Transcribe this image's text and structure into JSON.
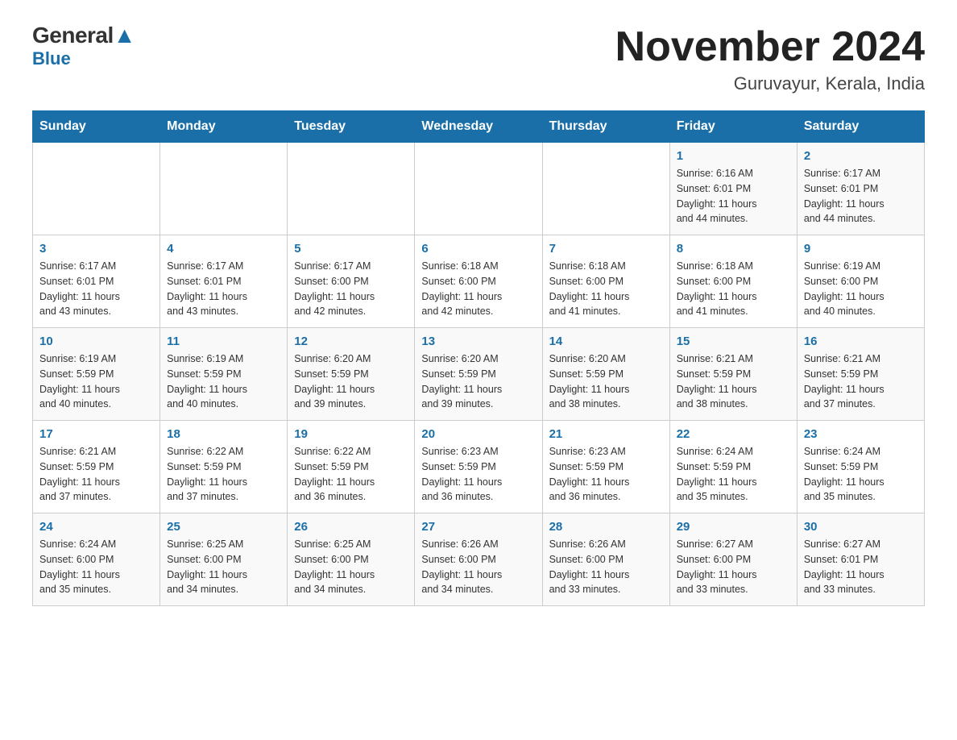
{
  "header": {
    "logo_general": "General",
    "logo_blue": "Blue",
    "month_title": "November 2024",
    "location": "Guruvayur, Kerala, India"
  },
  "days_of_week": [
    "Sunday",
    "Monday",
    "Tuesday",
    "Wednesday",
    "Thursday",
    "Friday",
    "Saturday"
  ],
  "weeks": [
    {
      "days": [
        {
          "number": "",
          "info": ""
        },
        {
          "number": "",
          "info": ""
        },
        {
          "number": "",
          "info": ""
        },
        {
          "number": "",
          "info": ""
        },
        {
          "number": "",
          "info": ""
        },
        {
          "number": "1",
          "info": "Sunrise: 6:16 AM\nSunset: 6:01 PM\nDaylight: 11 hours\nand 44 minutes."
        },
        {
          "number": "2",
          "info": "Sunrise: 6:17 AM\nSunset: 6:01 PM\nDaylight: 11 hours\nand 44 minutes."
        }
      ]
    },
    {
      "days": [
        {
          "number": "3",
          "info": "Sunrise: 6:17 AM\nSunset: 6:01 PM\nDaylight: 11 hours\nand 43 minutes."
        },
        {
          "number": "4",
          "info": "Sunrise: 6:17 AM\nSunset: 6:01 PM\nDaylight: 11 hours\nand 43 minutes."
        },
        {
          "number": "5",
          "info": "Sunrise: 6:17 AM\nSunset: 6:00 PM\nDaylight: 11 hours\nand 42 minutes."
        },
        {
          "number": "6",
          "info": "Sunrise: 6:18 AM\nSunset: 6:00 PM\nDaylight: 11 hours\nand 42 minutes."
        },
        {
          "number": "7",
          "info": "Sunrise: 6:18 AM\nSunset: 6:00 PM\nDaylight: 11 hours\nand 41 minutes."
        },
        {
          "number": "8",
          "info": "Sunrise: 6:18 AM\nSunset: 6:00 PM\nDaylight: 11 hours\nand 41 minutes."
        },
        {
          "number": "9",
          "info": "Sunrise: 6:19 AM\nSunset: 6:00 PM\nDaylight: 11 hours\nand 40 minutes."
        }
      ]
    },
    {
      "days": [
        {
          "number": "10",
          "info": "Sunrise: 6:19 AM\nSunset: 5:59 PM\nDaylight: 11 hours\nand 40 minutes."
        },
        {
          "number": "11",
          "info": "Sunrise: 6:19 AM\nSunset: 5:59 PM\nDaylight: 11 hours\nand 40 minutes."
        },
        {
          "number": "12",
          "info": "Sunrise: 6:20 AM\nSunset: 5:59 PM\nDaylight: 11 hours\nand 39 minutes."
        },
        {
          "number": "13",
          "info": "Sunrise: 6:20 AM\nSunset: 5:59 PM\nDaylight: 11 hours\nand 39 minutes."
        },
        {
          "number": "14",
          "info": "Sunrise: 6:20 AM\nSunset: 5:59 PM\nDaylight: 11 hours\nand 38 minutes."
        },
        {
          "number": "15",
          "info": "Sunrise: 6:21 AM\nSunset: 5:59 PM\nDaylight: 11 hours\nand 38 minutes."
        },
        {
          "number": "16",
          "info": "Sunrise: 6:21 AM\nSunset: 5:59 PM\nDaylight: 11 hours\nand 37 minutes."
        }
      ]
    },
    {
      "days": [
        {
          "number": "17",
          "info": "Sunrise: 6:21 AM\nSunset: 5:59 PM\nDaylight: 11 hours\nand 37 minutes."
        },
        {
          "number": "18",
          "info": "Sunrise: 6:22 AM\nSunset: 5:59 PM\nDaylight: 11 hours\nand 37 minutes."
        },
        {
          "number": "19",
          "info": "Sunrise: 6:22 AM\nSunset: 5:59 PM\nDaylight: 11 hours\nand 36 minutes."
        },
        {
          "number": "20",
          "info": "Sunrise: 6:23 AM\nSunset: 5:59 PM\nDaylight: 11 hours\nand 36 minutes."
        },
        {
          "number": "21",
          "info": "Sunrise: 6:23 AM\nSunset: 5:59 PM\nDaylight: 11 hours\nand 36 minutes."
        },
        {
          "number": "22",
          "info": "Sunrise: 6:24 AM\nSunset: 5:59 PM\nDaylight: 11 hours\nand 35 minutes."
        },
        {
          "number": "23",
          "info": "Sunrise: 6:24 AM\nSunset: 5:59 PM\nDaylight: 11 hours\nand 35 minutes."
        }
      ]
    },
    {
      "days": [
        {
          "number": "24",
          "info": "Sunrise: 6:24 AM\nSunset: 6:00 PM\nDaylight: 11 hours\nand 35 minutes."
        },
        {
          "number": "25",
          "info": "Sunrise: 6:25 AM\nSunset: 6:00 PM\nDaylight: 11 hours\nand 34 minutes."
        },
        {
          "number": "26",
          "info": "Sunrise: 6:25 AM\nSunset: 6:00 PM\nDaylight: 11 hours\nand 34 minutes."
        },
        {
          "number": "27",
          "info": "Sunrise: 6:26 AM\nSunset: 6:00 PM\nDaylight: 11 hours\nand 34 minutes."
        },
        {
          "number": "28",
          "info": "Sunrise: 6:26 AM\nSunset: 6:00 PM\nDaylight: 11 hours\nand 33 minutes."
        },
        {
          "number": "29",
          "info": "Sunrise: 6:27 AM\nSunset: 6:00 PM\nDaylight: 11 hours\nand 33 minutes."
        },
        {
          "number": "30",
          "info": "Sunrise: 6:27 AM\nSunset: 6:01 PM\nDaylight: 11 hours\nand 33 minutes."
        }
      ]
    }
  ]
}
